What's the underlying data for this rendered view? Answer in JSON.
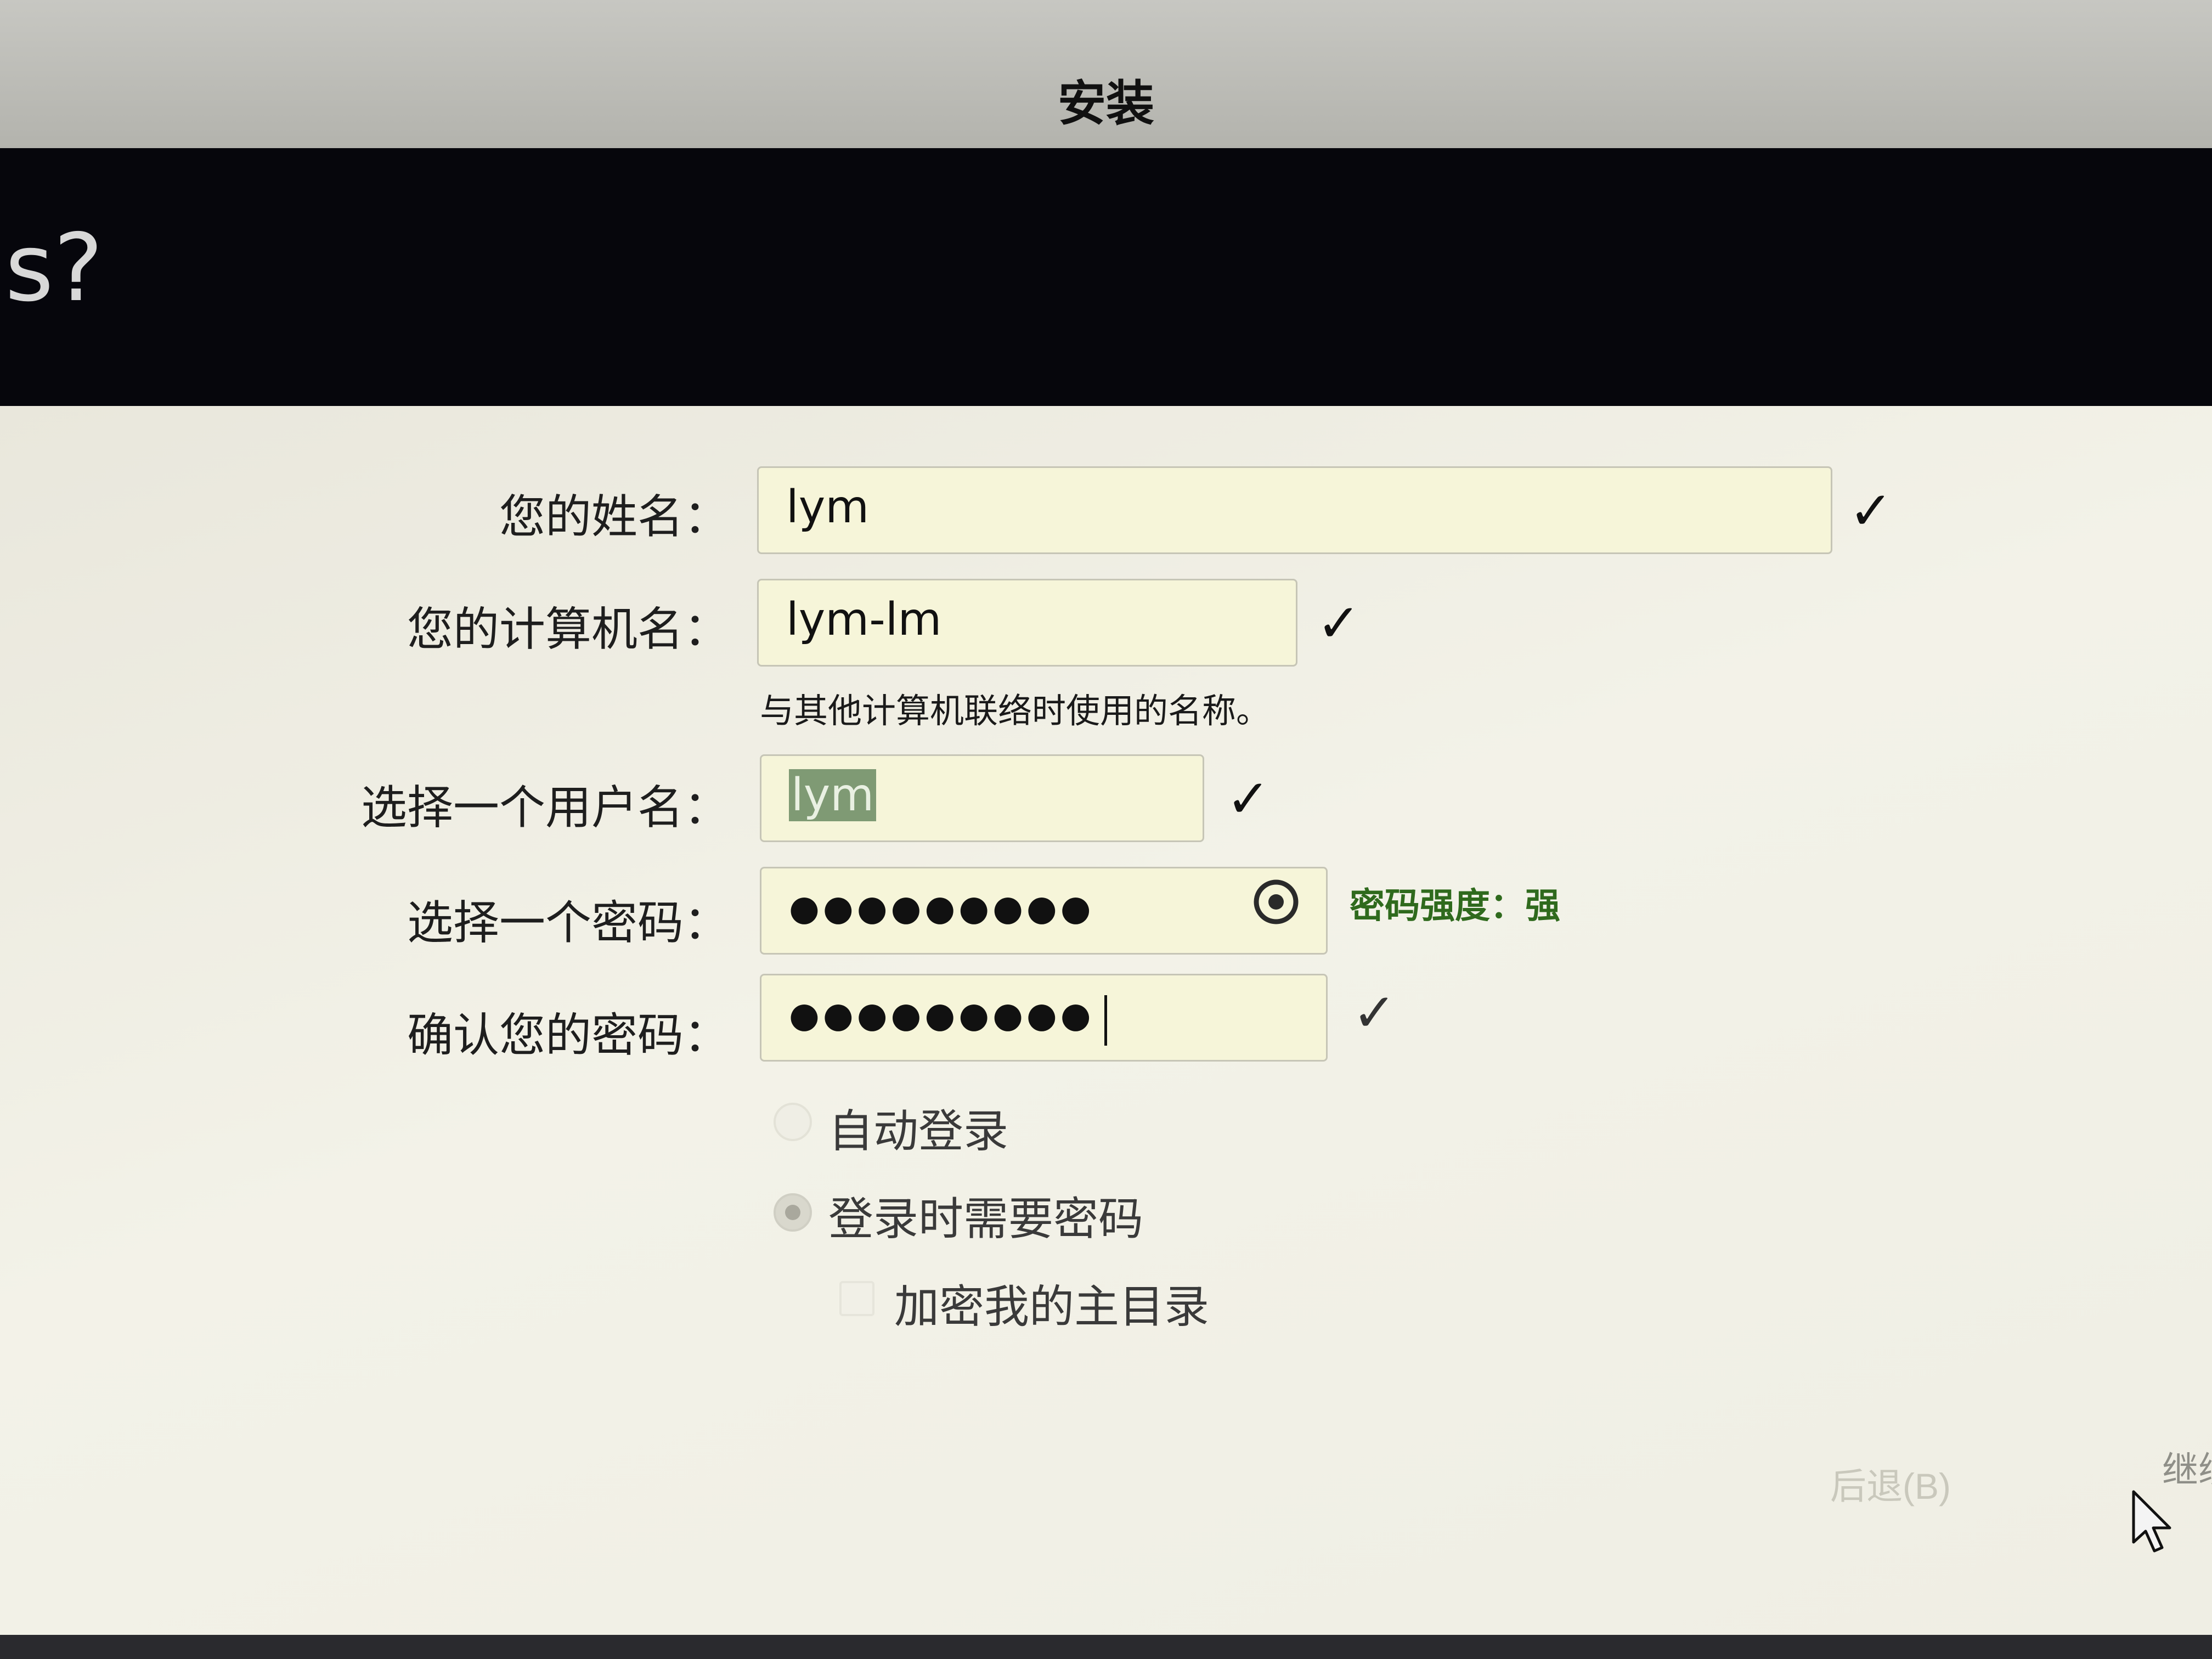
{
  "window": {
    "title": "安装"
  },
  "header": {
    "heading": "is?"
  },
  "form": {
    "name": {
      "label": "您的姓名：",
      "value": "lym",
      "valid": true
    },
    "computer": {
      "label": "您的计算机名：",
      "value": "lym-lm",
      "valid": true,
      "hint": "与其他计算机联络时使用的名称。"
    },
    "username": {
      "label": "选择一个用户名：",
      "value": "lym",
      "valid": true
    },
    "password": {
      "label": "选择一个密码：",
      "masked": "●●●●●●●●●",
      "strength": "密码强度：强",
      "toggle_icon": "eye-icon"
    },
    "confirm": {
      "label": "确认您的密码：",
      "masked": "●●●●●●●●●",
      "valid": true
    }
  },
  "options": {
    "auto_login": "自动登录",
    "require_password": "登录时需要密码",
    "encrypt_home": "加密我的主目录",
    "selected": "require_password"
  },
  "buttons": {
    "back": "后退(B)",
    "continue": "继续"
  },
  "icons": {
    "valid": "check-icon",
    "cursor": "mouse-pointer-icon"
  },
  "colors": {
    "strength_text": "#2f6a1d",
    "field_bg": "#f6f5d9",
    "header_bg": "#06060c"
  }
}
